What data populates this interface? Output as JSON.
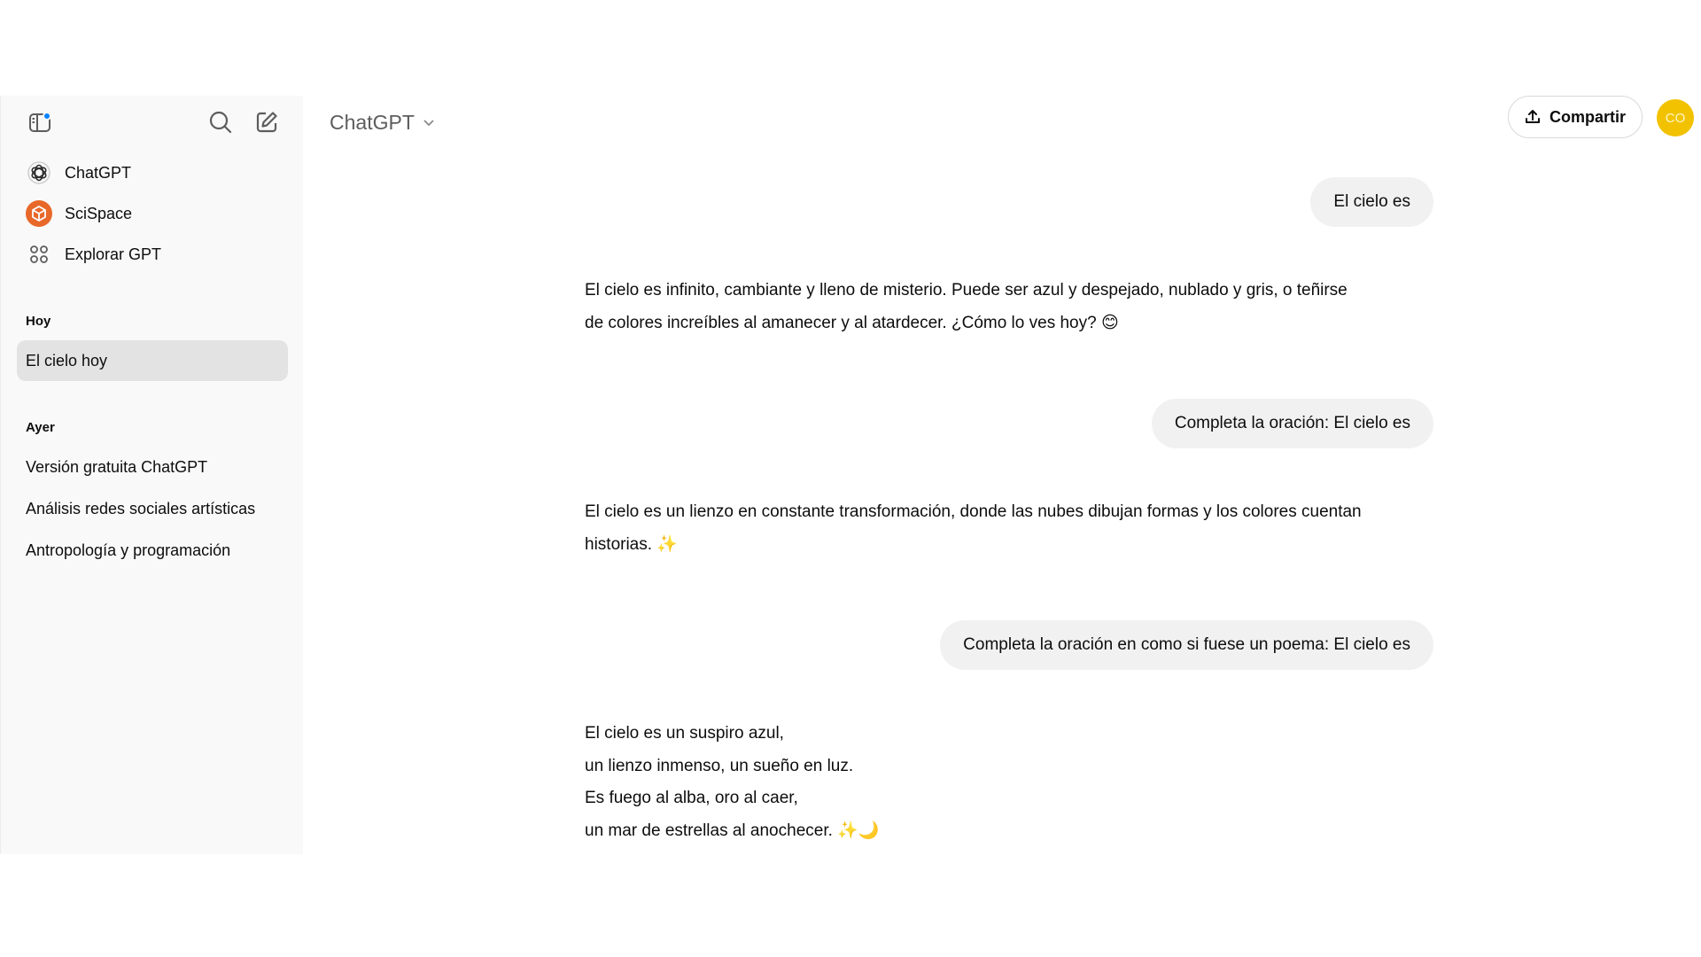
{
  "sidebar": {
    "links": [
      {
        "label": "ChatGPT",
        "icon": "openai-logo-icon"
      },
      {
        "label": "SciSpace",
        "icon": "scispace-logo-icon"
      },
      {
        "label": "Explorar GPT",
        "icon": "grid-icon"
      }
    ],
    "today_heading": "Hoy",
    "today_items": [
      "El cielo hoy"
    ],
    "yesterday_heading": "Ayer",
    "yesterday_items": [
      "Versión gratuita ChatGPT",
      "Análisis redes sociales artísticas",
      "Antropología y programación"
    ]
  },
  "header": {
    "model_name": "ChatGPT",
    "share_label": "Compartir",
    "avatar_initials": "CO"
  },
  "messages": [
    {
      "role": "user",
      "text": "El cielo es"
    },
    {
      "role": "assistant",
      "lines": [
        "El cielo es infinito, cambiante y lleno de misterio. Puede ser azul y despejado, nublado y gris, o teñirse",
        "de colores increíbles al amanecer y al atardecer. ¿Cómo lo ves hoy? 😊"
      ]
    },
    {
      "role": "user",
      "text": "Completa la oración: El cielo es"
    },
    {
      "role": "assistant",
      "lines": [
        "El cielo es un lienzo en constante transformación, donde las nubes dibujan formas y los colores cuentan",
        "historias. ✨"
      ]
    },
    {
      "role": "user",
      "text": "Completa la oración en como si fuese un poema: El cielo es"
    },
    {
      "role": "assistant",
      "lines": [
        "El cielo es un suspiro azul,",
        "un lienzo inmenso, un sueño en luz.",
        "Es fuego al alba, oro al caer,",
        "un mar de estrellas al anochecer. ✨🌙"
      ]
    }
  ],
  "colors": {
    "accent_dot": "#0a84ff",
    "avatar_bg": "#f2c200",
    "scispace_brand": "#e8682a"
  }
}
